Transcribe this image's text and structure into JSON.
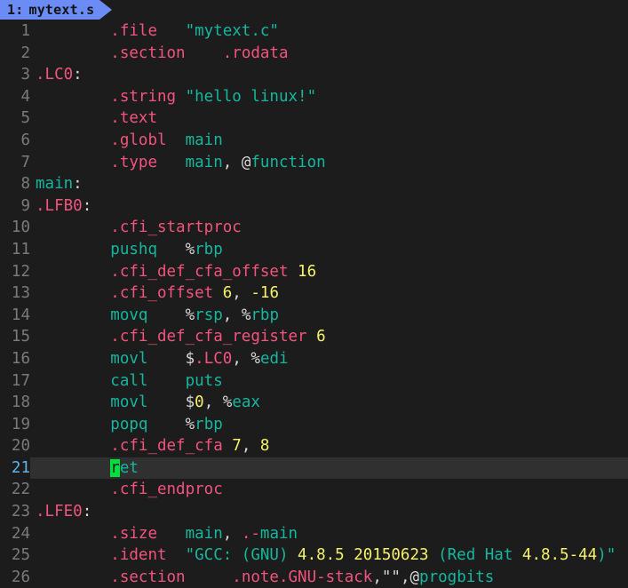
{
  "window": {
    "kind": "terminal-text-editor",
    "background": "#1c1c1c",
    "current_line_background": "#303030"
  },
  "tabbar": {
    "active_tab": {
      "number": "1:",
      "filename": "mytext.s",
      "background": "#6b8bf5",
      "text_color": "#141414"
    }
  },
  "editor": {
    "cursor": {
      "line": 21,
      "column": 9,
      "char": "r",
      "color": "#00e03c"
    },
    "current_line": 21,
    "colors": {
      "directive": "#f2547d",
      "identifier": "#15b79e",
      "number": "#f5f26a",
      "punctuation": "#d8d8d8",
      "line_number": "#7a7a7a",
      "current_line_number": "#5fb4e8"
    },
    "lines": [
      {
        "num": "1",
        "tokens": [
          {
            "t": "        ",
            "k": "c"
          },
          {
            "t": ".file",
            "k": "d"
          },
          {
            "t": "   ",
            "k": "c"
          },
          {
            "t": "\"mytext.c\"",
            "k": "s"
          }
        ]
      },
      {
        "num": "2",
        "tokens": [
          {
            "t": "        ",
            "k": "c"
          },
          {
            "t": ".section",
            "k": "d"
          },
          {
            "t": "    ",
            "k": "c"
          },
          {
            "t": ".rodata",
            "k": "d"
          }
        ]
      },
      {
        "num": "3",
        "tokens": [
          {
            "t": ".LC0",
            "k": "d"
          },
          {
            "t": ":",
            "k": "p"
          }
        ]
      },
      {
        "num": "4",
        "tokens": [
          {
            "t": "        ",
            "k": "c"
          },
          {
            "t": ".string",
            "k": "d"
          },
          {
            "t": " ",
            "k": "c"
          },
          {
            "t": "\"hello linux!\"",
            "k": "s"
          }
        ]
      },
      {
        "num": "5",
        "tokens": [
          {
            "t": "        ",
            "k": "c"
          },
          {
            "t": ".text",
            "k": "d"
          }
        ]
      },
      {
        "num": "6",
        "tokens": [
          {
            "t": "        ",
            "k": "c"
          },
          {
            "t": ".globl",
            "k": "d"
          },
          {
            "t": "  ",
            "k": "c"
          },
          {
            "t": "main",
            "k": "s"
          }
        ]
      },
      {
        "num": "7",
        "tokens": [
          {
            "t": "        ",
            "k": "c"
          },
          {
            "t": ".type",
            "k": "d"
          },
          {
            "t": "   ",
            "k": "c"
          },
          {
            "t": "main",
            "k": "s"
          },
          {
            "t": ", ",
            "k": "p"
          },
          {
            "t": "@",
            "k": "p"
          },
          {
            "t": "function",
            "k": "s"
          }
        ]
      },
      {
        "num": "8",
        "tokens": [
          {
            "t": "main",
            "k": "s"
          },
          {
            "t": ":",
            "k": "p"
          }
        ]
      },
      {
        "num": "9",
        "tokens": [
          {
            "t": ".LFB0",
            "k": "d"
          },
          {
            "t": ":",
            "k": "p"
          }
        ]
      },
      {
        "num": "10",
        "tokens": [
          {
            "t": "        ",
            "k": "c"
          },
          {
            "t": ".cfi_startproc",
            "k": "d"
          }
        ]
      },
      {
        "num": "11",
        "tokens": [
          {
            "t": "        ",
            "k": "c"
          },
          {
            "t": "pushq",
            "k": "s"
          },
          {
            "t": "   ",
            "k": "c"
          },
          {
            "t": "%",
            "k": "p"
          },
          {
            "t": "rbp",
            "k": "s"
          }
        ]
      },
      {
        "num": "12",
        "tokens": [
          {
            "t": "        ",
            "k": "c"
          },
          {
            "t": ".cfi_def_cfa_offset",
            "k": "d"
          },
          {
            "t": " ",
            "k": "c"
          },
          {
            "t": "16",
            "k": "n"
          }
        ]
      },
      {
        "num": "13",
        "tokens": [
          {
            "t": "        ",
            "k": "c"
          },
          {
            "t": ".cfi_offset",
            "k": "d"
          },
          {
            "t": " ",
            "k": "c"
          },
          {
            "t": "6",
            "k": "n"
          },
          {
            "t": ", ",
            "k": "p"
          },
          {
            "t": "-16",
            "k": "n"
          }
        ]
      },
      {
        "num": "14",
        "tokens": [
          {
            "t": "        ",
            "k": "c"
          },
          {
            "t": "movq",
            "k": "s"
          },
          {
            "t": "    ",
            "k": "c"
          },
          {
            "t": "%",
            "k": "p"
          },
          {
            "t": "rsp",
            "k": "s"
          },
          {
            "t": ", ",
            "k": "p"
          },
          {
            "t": "%",
            "k": "p"
          },
          {
            "t": "rbp",
            "k": "s"
          }
        ]
      },
      {
        "num": "15",
        "tokens": [
          {
            "t": "        ",
            "k": "c"
          },
          {
            "t": ".cfi_def_cfa_register",
            "k": "d"
          },
          {
            "t": " ",
            "k": "c"
          },
          {
            "t": "6",
            "k": "n"
          }
        ]
      },
      {
        "num": "16",
        "tokens": [
          {
            "t": "        ",
            "k": "c"
          },
          {
            "t": "movl",
            "k": "s"
          },
          {
            "t": "    ",
            "k": "c"
          },
          {
            "t": "$",
            "k": "p"
          },
          {
            "t": ".LC0",
            "k": "d"
          },
          {
            "t": ", ",
            "k": "p"
          },
          {
            "t": "%",
            "k": "p"
          },
          {
            "t": "edi",
            "k": "s"
          }
        ]
      },
      {
        "num": "17",
        "tokens": [
          {
            "t": "        ",
            "k": "c"
          },
          {
            "t": "call",
            "k": "s"
          },
          {
            "t": "    ",
            "k": "c"
          },
          {
            "t": "puts",
            "k": "s"
          }
        ]
      },
      {
        "num": "18",
        "tokens": [
          {
            "t": "        ",
            "k": "c"
          },
          {
            "t": "movl",
            "k": "s"
          },
          {
            "t": "    ",
            "k": "c"
          },
          {
            "t": "$",
            "k": "p"
          },
          {
            "t": "0",
            "k": "n"
          },
          {
            "t": ", ",
            "k": "p"
          },
          {
            "t": "%",
            "k": "p"
          },
          {
            "t": "eax",
            "k": "s"
          }
        ]
      },
      {
        "num": "19",
        "tokens": [
          {
            "t": "        ",
            "k": "c"
          },
          {
            "t": "popq",
            "k": "s"
          },
          {
            "t": "    ",
            "k": "c"
          },
          {
            "t": "%",
            "k": "p"
          },
          {
            "t": "rbp",
            "k": "s"
          }
        ]
      },
      {
        "num": "20",
        "tokens": [
          {
            "t": "        ",
            "k": "c"
          },
          {
            "t": ".cfi_def_cfa",
            "k": "d"
          },
          {
            "t": " ",
            "k": "c"
          },
          {
            "t": "7",
            "k": "n"
          },
          {
            "t": ", ",
            "k": "p"
          },
          {
            "t": "8",
            "k": "n"
          }
        ]
      },
      {
        "num": "21",
        "current": true,
        "tokens": [
          {
            "t": "        ",
            "k": "c"
          },
          {
            "t": "r",
            "k": "cursor"
          },
          {
            "t": "et",
            "k": "s"
          }
        ]
      },
      {
        "num": "22",
        "tokens": [
          {
            "t": "        ",
            "k": "c"
          },
          {
            "t": ".cfi_endproc",
            "k": "d"
          }
        ]
      },
      {
        "num": "23",
        "tokens": [
          {
            "t": ".LFE0",
            "k": "d"
          },
          {
            "t": ":",
            "k": "p"
          }
        ]
      },
      {
        "num": "24",
        "tokens": [
          {
            "t": "        ",
            "k": "c"
          },
          {
            "t": ".size",
            "k": "d"
          },
          {
            "t": "   ",
            "k": "c"
          },
          {
            "t": "main",
            "k": "s"
          },
          {
            "t": ", ",
            "k": "p"
          },
          {
            "t": ".-",
            "k": "d"
          },
          {
            "t": "main",
            "k": "s"
          }
        ]
      },
      {
        "num": "25",
        "tokens": [
          {
            "t": "        ",
            "k": "c"
          },
          {
            "t": ".ident",
            "k": "d"
          },
          {
            "t": "  ",
            "k": "c"
          },
          {
            "t": "\"GCC: (GNU) ",
            "k": "s"
          },
          {
            "t": "4.8.5 20150623",
            "k": "n"
          },
          {
            "t": " (Red Hat ",
            "k": "s"
          },
          {
            "t": "4.8.5-44",
            "k": "n"
          },
          {
            "t": ")\"",
            "k": "s"
          }
        ]
      },
      {
        "num": "26",
        "tokens": [
          {
            "t": "        ",
            "k": "c"
          },
          {
            "t": ".section",
            "k": "d"
          },
          {
            "t": "     ",
            "k": "c"
          },
          {
            "t": ".note.GNU-stack",
            "k": "d"
          },
          {
            "t": ",",
            "k": "p"
          },
          {
            "t": "\"\"",
            "k": "p"
          },
          {
            "t": ",",
            "k": "p"
          },
          {
            "t": "@",
            "k": "p"
          },
          {
            "t": "progbits",
            "k": "s"
          }
        ]
      }
    ]
  }
}
